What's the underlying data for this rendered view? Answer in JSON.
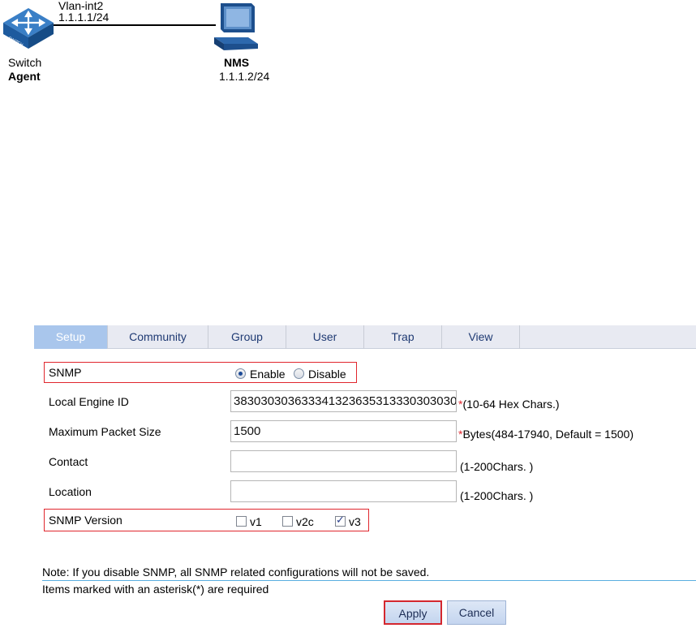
{
  "topology": {
    "interface_name": "Vlan-int2",
    "interface_ip": "1.1.1.1/24",
    "switch_label": "Switch",
    "switch_role": "Agent",
    "switch_icon_text": "SWITCH",
    "nms_label": "NMS",
    "nms_ip": "1.1.1.2/24"
  },
  "tabs": [
    {
      "label": "Setup",
      "active": true
    },
    {
      "label": "Community",
      "active": false
    },
    {
      "label": "Group",
      "active": false
    },
    {
      "label": "User",
      "active": false
    },
    {
      "label": "Trap",
      "active": false
    },
    {
      "label": "View",
      "active": false
    }
  ],
  "form": {
    "snmp": {
      "label": "SNMP",
      "enable_label": "Enable",
      "disable_label": "Disable",
      "selected": "Enable"
    },
    "engine_id": {
      "label": "Local Engine ID",
      "value": "383030303633341323635313330303030",
      "hint": "(10-64 Hex Chars.)"
    },
    "packet_size": {
      "label": "Maximum Packet Size",
      "value": "1500",
      "hint": "Bytes(484-17940, Default = 1500)"
    },
    "contact": {
      "label": "Contact",
      "value": "",
      "hint": "(1-200Chars. )"
    },
    "location": {
      "label": "Location",
      "value": "",
      "hint": "(1-200Chars. )"
    },
    "version": {
      "label": "SNMP Version",
      "v1_label": "v1",
      "v1_checked": false,
      "v2c_label": "v2c",
      "v2c_checked": false,
      "v3_label": "v3",
      "v3_checked": true
    },
    "required_mark": "*"
  },
  "note": "Note: If you disable SNMP, all SNMP related configurations will not be saved.",
  "required_note": "Items marked with an asterisk(*) are required",
  "buttons": {
    "apply": "Apply",
    "cancel": "Cancel"
  },
  "colors": {
    "highlight_box": "#e0262d",
    "active_tab": "#a9c6ec",
    "separator": "#5aaee0"
  }
}
